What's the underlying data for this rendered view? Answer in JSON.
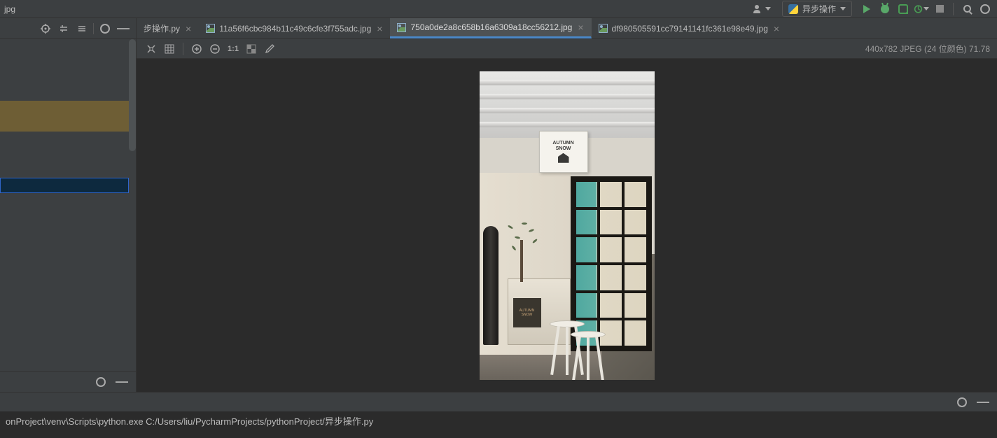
{
  "titlebar": {
    "filename": "jpg"
  },
  "runconfig": {
    "label": "异步操作"
  },
  "tabs": [
    {
      "label": "步操作.py",
      "active": false,
      "type": "py"
    },
    {
      "label": "11a56f6cbc984b11c49c6cfe3f755adc.jpg",
      "active": false,
      "type": "img"
    },
    {
      "label": "750a0de2a8c658b16a6309a18cc56212.jpg",
      "active": true,
      "type": "img"
    },
    {
      "label": "df980505591cc79141141fc361e98e49.jpg",
      "active": false,
      "type": "img"
    }
  ],
  "image_toolbar": {
    "one_to_one": "1:1",
    "info": "440x782 JPEG (24 位颜色) 71.78"
  },
  "sign": {
    "line1": "AUTUMN",
    "line2": "SNOW"
  },
  "counter_sign": {
    "line1": "AUTUMN",
    "line2": "SNOW"
  },
  "console": {
    "line": "onProject\\venv\\Scripts\\python.exe  C:/Users/liu/PycharmProjects/pythonProject/异步操作.py"
  }
}
